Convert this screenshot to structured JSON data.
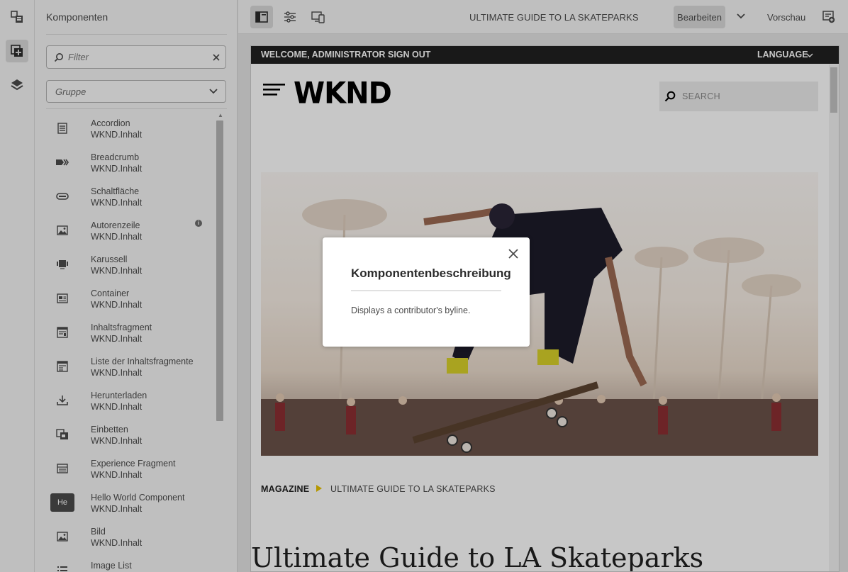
{
  "rail": {
    "items": [
      {
        "icon": "page-tree-icon"
      },
      {
        "icon": "components-icon",
        "active": true
      },
      {
        "icon": "layers-icon"
      }
    ]
  },
  "components_panel": {
    "title": "Komponenten",
    "filter": {
      "placeholder": "Filter",
      "value": ""
    },
    "group": {
      "placeholder": "Gruppe"
    },
    "items": [
      {
        "name": "Accordion",
        "group": "WKND.Inhalt",
        "icon": "accordion-icon"
      },
      {
        "name": "Breadcrumb",
        "group": "WKND.Inhalt",
        "icon": "breadcrumb-icon"
      },
      {
        "name": "Schaltfläche",
        "group": "WKND.Inhalt",
        "icon": "button-icon"
      },
      {
        "name": "Autorenzeile",
        "group": "WKND.Inhalt",
        "icon": "image-icon",
        "info": true
      },
      {
        "name": "Karussell",
        "group": "WKND.Inhalt",
        "icon": "carousel-icon"
      },
      {
        "name": "Container",
        "group": "WKND.Inhalt",
        "icon": "container-icon"
      },
      {
        "name": "Inhaltsfragment",
        "group": "WKND.Inhalt",
        "icon": "content-fragment-icon"
      },
      {
        "name": "Liste der Inhaltsfragmente",
        "group": "WKND.Inhalt",
        "icon": "content-fragment-list-icon"
      },
      {
        "name": "Herunterladen",
        "group": "WKND.Inhalt",
        "icon": "download-icon"
      },
      {
        "name": "Einbetten",
        "group": "WKND.Inhalt",
        "icon": "embed-icon"
      },
      {
        "name": "Experience Fragment",
        "group": "WKND.Inhalt",
        "icon": "experience-fragment-icon"
      },
      {
        "name": "Hello World Component",
        "group": "WKND.Inhalt",
        "icon": "he-badge-icon",
        "badge": "He"
      },
      {
        "name": "Bild",
        "group": "WKND.Inhalt",
        "icon": "image-icon"
      },
      {
        "name": "Image List",
        "group": "",
        "icon": "list-icon"
      }
    ]
  },
  "toolbar": {
    "title": "ULTIMATE GUIDE TO LA SKATEPARKS",
    "edit_label": "Bearbeiten",
    "preview_label": "Vorschau"
  },
  "page": {
    "welcome": "WELCOME, ADMINISTRATOR",
    "signout": "SIGN OUT",
    "language": "LANGUAGE",
    "logo": "WKND",
    "search_placeholder": "SEARCH",
    "breadcrumb": [
      "MAGAZINE",
      "ULTIMATE GUIDE TO LA SKATEPARKS"
    ],
    "heading": "Ultimate Guide to LA Skateparks"
  },
  "dialog": {
    "title": "Komponentenbeschreibung",
    "body": "Displays a contributor's byline."
  },
  "colors": {
    "accent_yellow": "#e8c200",
    "dark_bar": "#202020"
  }
}
